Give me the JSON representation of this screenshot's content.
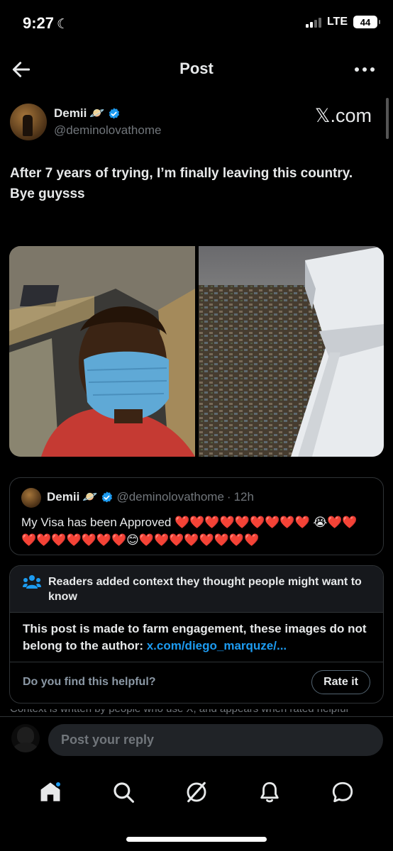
{
  "status_bar": {
    "time": "9:27",
    "network": "LTE",
    "battery": "44"
  },
  "header": {
    "title": "Post"
  },
  "author": {
    "name": "Demii",
    "handle": "@deminolovathome",
    "source": "𝕏.com"
  },
  "tweet": {
    "lines": [
      "After 7 years of trying, I’m finally leaving this country.",
      "Bye guysss"
    ]
  },
  "quote": {
    "name": "Demii",
    "handle": "@deminolovathome",
    "separator": "·",
    "time": "12h",
    "text": "My Visa has been Approved  ❤️❤️❤️❤️❤️❤️❤️❤️❤️ 😭❤️❤️❤️❤️❤️❤️❤️❤️❤️😊❤️❤️❤️❤️❤️❤️❤️❤️"
  },
  "note": {
    "title": "Readers added context they thought people might want to know",
    "body": "This post is made to farm engagement, these images do not belong to the author: ",
    "link": "x.com/diego_marquze/...",
    "question": "Do you find this helpful?",
    "rate_label": "Rate it"
  },
  "cutoff_text": "Context is written by people who use X, and appears when rated helpful",
  "reply": {
    "placeholder": "Post your reply"
  },
  "colors": {
    "accent": "#1d9bf0",
    "background": "#000000",
    "muted": "#71767b",
    "border": "#2f3336"
  },
  "bottom_nav": [
    "home-icon",
    "search-icon",
    "grok-icon",
    "notifications-icon",
    "messages-icon"
  ]
}
